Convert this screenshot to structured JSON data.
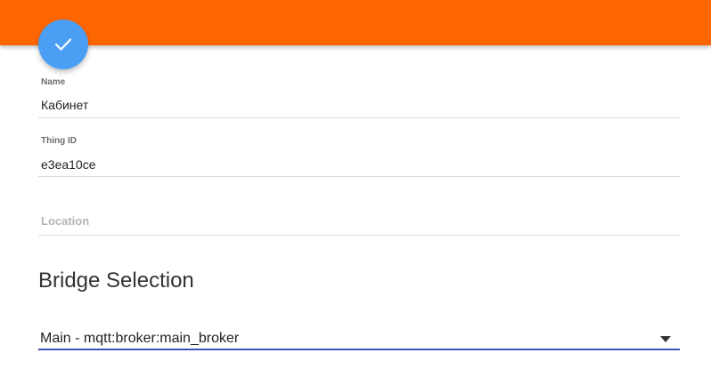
{
  "header": {
    "color": "#ff6600"
  },
  "fab": {
    "icon": "check-icon",
    "color": "#4a9ff5"
  },
  "form": {
    "name": {
      "label": "Name",
      "value": "Кабинет"
    },
    "thing_id": {
      "label": "Thing ID",
      "value": "e3ea10ce"
    },
    "location": {
      "placeholder": "Location",
      "value": ""
    }
  },
  "bridge": {
    "title": "Bridge Selection",
    "selected": "Main - mqtt:broker:main_broker",
    "accent": "#3f51b5"
  }
}
